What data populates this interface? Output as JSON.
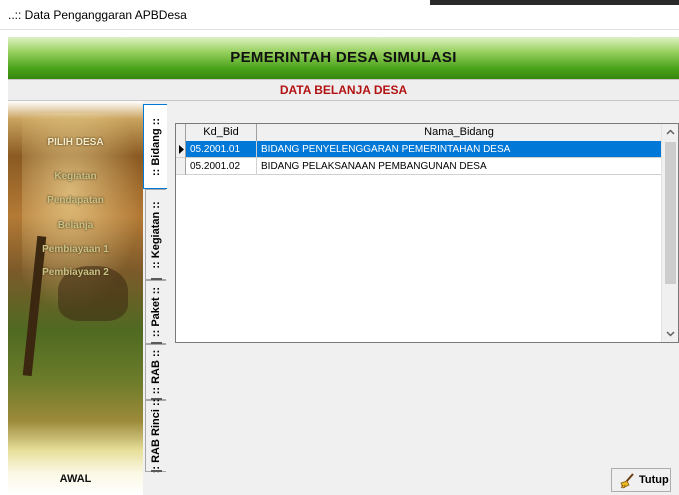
{
  "window": {
    "title": "..:: Data Penganggaran APBDesa"
  },
  "header": {
    "title": "PEMERINTAH DESA SIMULASI",
    "subtitle": "DATA BELANJA DESA"
  },
  "sidebar": {
    "items": [
      {
        "label": "PILIH DESA"
      },
      {
        "label": "Kegiatan"
      },
      {
        "label": "Pendapatan"
      },
      {
        "label": "Belanja"
      },
      {
        "label": "Pembiayaan 1"
      },
      {
        "label": "Pembiayaan 2"
      }
    ],
    "bottom_label": "AWAL"
  },
  "tabs": [
    {
      "label": ":: Bidang ::",
      "active": true
    },
    {
      "label": ":: Kegiatan ::",
      "active": false
    },
    {
      "label": ":: Paket ::",
      "active": false
    },
    {
      "label": ":: RAB ::",
      "active": false
    },
    {
      "label": ":: RAB Rinci ::",
      "active": false
    }
  ],
  "grid": {
    "columns": [
      "Kd_Bid",
      "Nama_Bidang"
    ],
    "rows": [
      {
        "kd_bid": "05.2001.01",
        "nama_bidang": "BIDANG PENYELENGGARAN PEMERINTAHAN DESA",
        "selected": true
      },
      {
        "kd_bid": "05.2001.02",
        "nama_bidang": "BIDANG PELAKSANAAN PEMBANGUNAN DESA",
        "selected": false
      }
    ]
  },
  "buttons": {
    "close_label": "Tutup"
  },
  "icons": {
    "row_indicator": "row-indicator-icon",
    "scroll_up": "scroll-up-icon",
    "scroll_down": "scroll-down-icon",
    "close_button": "broom-icon"
  },
  "colors": {
    "header_green": "#4aa21a",
    "subtitle_red": "#b31212",
    "selection_blue": "#0078d7"
  }
}
